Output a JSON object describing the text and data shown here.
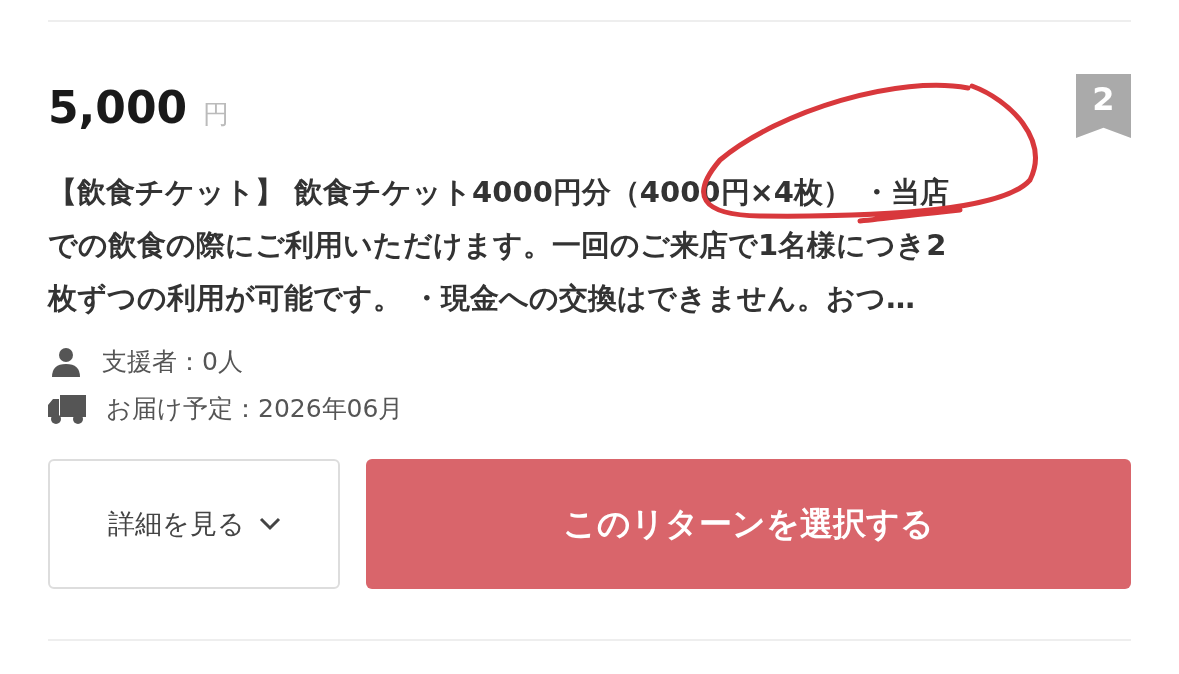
{
  "reward": {
    "price": "5,000",
    "currency": "円",
    "badge": "2",
    "description_lines": [
      "【飲食チケット】 飲食チケット4000円分（4000円×4枚） ・当店",
      "での飲食の際にご利用いただけます。一回のご来店で1名様につき2",
      "枚ずつの利用が可能です。 ・現金への交換はできません。おつ…"
    ],
    "meta": [
      {
        "kind": "backers",
        "text": "支援者：0人"
      },
      {
        "kind": "delivery",
        "text": "お届け予定：2026年06月"
      }
    ],
    "details_button": "詳細を見る",
    "select_button": "このリターンを選択する"
  }
}
